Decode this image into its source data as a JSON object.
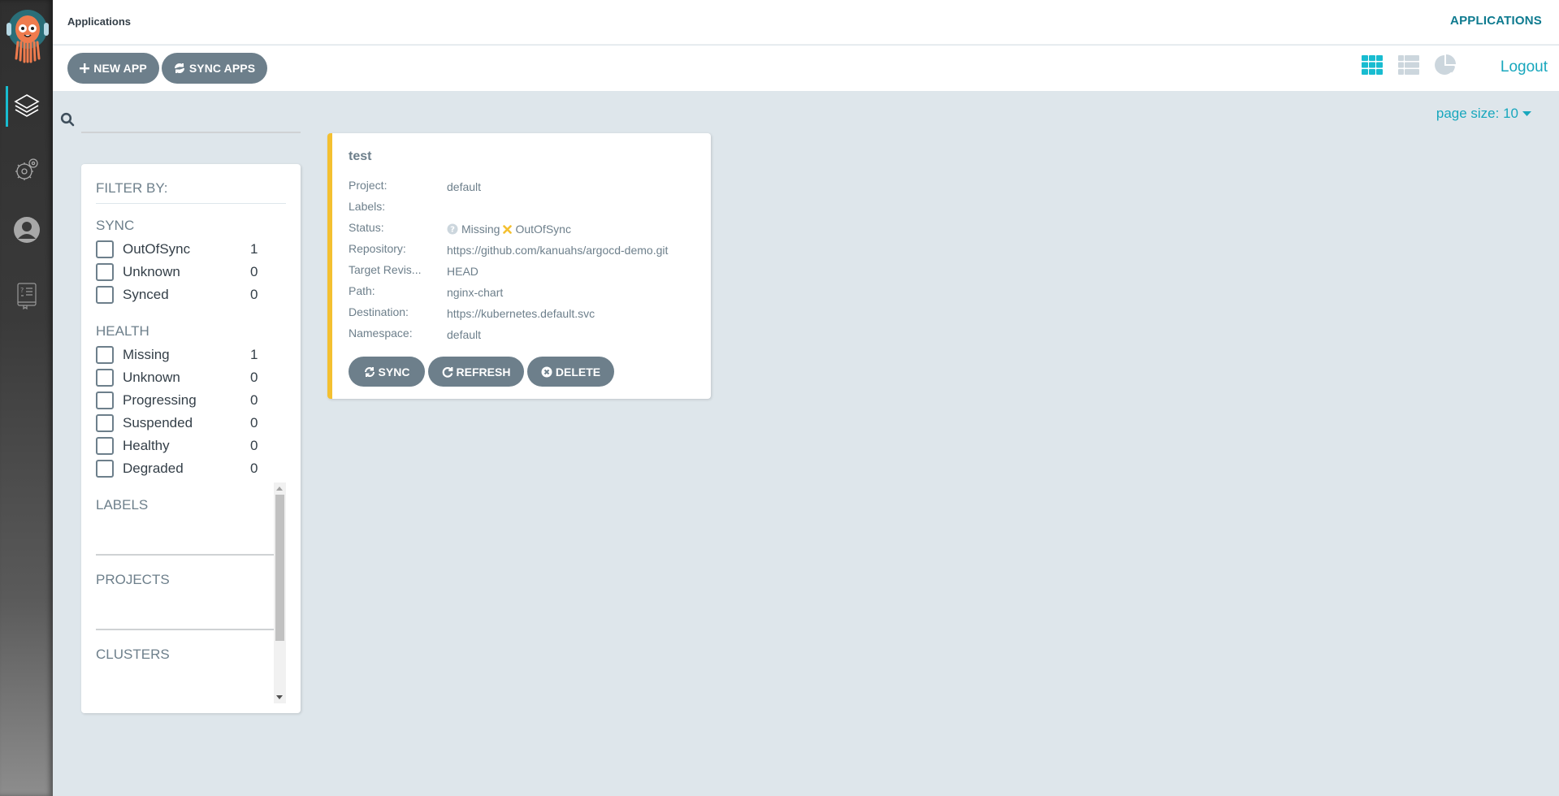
{
  "header": {
    "title": "Applications",
    "top_link": "APPLICATIONS"
  },
  "toolbar": {
    "new_app_label": "NEW APP",
    "sync_apps_label": "SYNC APPS",
    "logout_label": "Logout",
    "views": [
      "tiles",
      "list",
      "summary"
    ],
    "active_view": "tiles"
  },
  "sidebar": {
    "items": [
      {
        "name": "applications",
        "icon": "layers-icon",
        "active": true
      },
      {
        "name": "settings",
        "icon": "gears-icon",
        "active": false
      },
      {
        "name": "user-info",
        "icon": "user-icon",
        "active": false
      },
      {
        "name": "documentation",
        "icon": "help-book-icon",
        "active": false
      }
    ]
  },
  "search": {
    "value": "",
    "placeholder": ""
  },
  "page_size": {
    "label": "page size: 10"
  },
  "filters": {
    "title": "FILTER BY:",
    "sync": {
      "heading": "SYNC",
      "items": [
        {
          "label": "OutOfSync",
          "count": "1",
          "checked": false
        },
        {
          "label": "Unknown",
          "count": "0",
          "checked": false
        },
        {
          "label": "Synced",
          "count": "0",
          "checked": false
        }
      ]
    },
    "health": {
      "heading": "HEALTH",
      "items": [
        {
          "label": "Missing",
          "count": "1",
          "checked": false
        },
        {
          "label": "Unknown",
          "count": "0",
          "checked": false
        },
        {
          "label": "Progressing",
          "count": "0",
          "checked": false
        },
        {
          "label": "Suspended",
          "count": "0",
          "checked": false
        },
        {
          "label": "Healthy",
          "count": "0",
          "checked": false
        },
        {
          "label": "Degraded",
          "count": "0",
          "checked": false
        }
      ]
    },
    "labels_heading": "LABELS",
    "projects_heading": "PROJECTS",
    "clusters_heading": "CLUSTERS"
  },
  "app_card": {
    "name": "test",
    "fields": [
      {
        "key": "Project:",
        "value": "default"
      },
      {
        "key": "Labels:",
        "value": ""
      },
      {
        "key": "Status:",
        "health": "Missing",
        "sync": "OutOfSync"
      },
      {
        "key": "Repository:",
        "value": "https://github.com/kanuahs/argocd-demo.git"
      },
      {
        "key": "Target Revis...",
        "value": "HEAD"
      },
      {
        "key": "Path:",
        "value": "nginx-chart"
      },
      {
        "key": "Destination:",
        "value": "https://kubernetes.default.svc"
      },
      {
        "key": "Namespace:",
        "value": "default"
      }
    ],
    "buttons": {
      "sync": "SYNC",
      "refresh": "REFRESH",
      "delete": "DELETE"
    },
    "status_colors": {
      "border": "#f4c030",
      "missing": "#ccd6dd",
      "out_of_sync": "#f4c030"
    }
  },
  "colors": {
    "accent": "#18bcd0",
    "link": "#18a7bd",
    "button": "#6d7f8b",
    "background": "#dee6eb"
  }
}
